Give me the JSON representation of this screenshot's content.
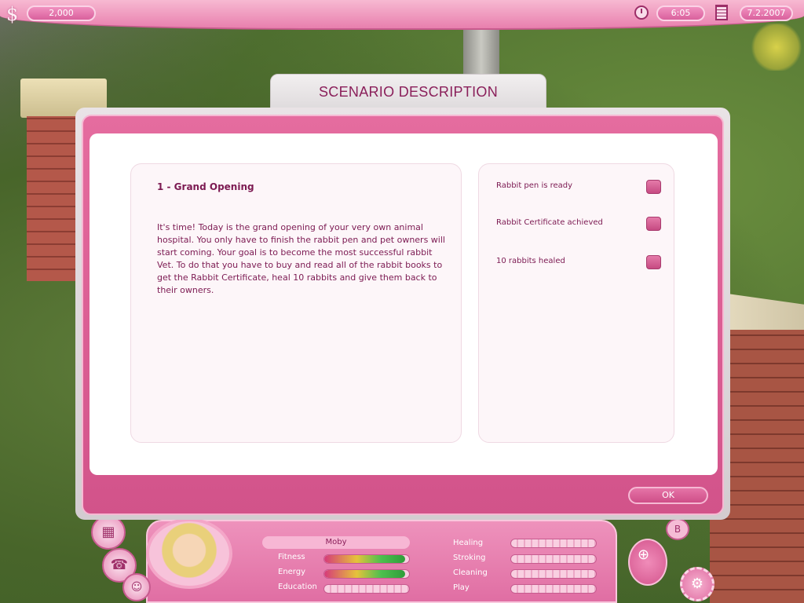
{
  "topbar": {
    "currency_symbol": "$",
    "money": "2,000",
    "time": "6:05",
    "date": "7.2.2007"
  },
  "dialog": {
    "title": "SCENARIO DESCRIPTION",
    "scenario_title": "1 - Grand Opening",
    "scenario_text": "It's time! Today is the grand opening of your very own animal hospital. You only have to finish the rabbit pen and pet owners will start coming. Your goal is to become the most successful rabbit Vet. To do that you have to buy and read all of the rabbit books to get the Rabbit Certificate, heal 10 rabbits and give them back to their owners.",
    "goals": [
      {
        "label": "Rabbit pen is ready"
      },
      {
        "label": "Rabbit Certificate achieved"
      },
      {
        "label": "10 rabbits healed"
      }
    ],
    "ok_label": "OK"
  },
  "hud": {
    "character_name": "Moby",
    "stats": [
      {
        "label": "Fitness",
        "value": 0.95
      },
      {
        "label": "Energy",
        "value": 0.95
      },
      {
        "label": "Education",
        "value": 0.0
      }
    ],
    "skills": [
      {
        "label": "Healing"
      },
      {
        "label": "Stroking"
      },
      {
        "label": "Cleaning"
      },
      {
        "label": "Play"
      }
    ]
  },
  "icons": {
    "money": "dollar-icon",
    "clock": "clock-icon",
    "calendar": "calculator-icon",
    "crib": "crib-icon",
    "phone": "phone-icon",
    "character": "character-icon",
    "nav": "navigation-wheel-icon",
    "settings": "gear-icon"
  },
  "colors": {
    "accent_pink": "#e56c9f",
    "title_text": "#8a1f5a",
    "body_text": "#7c1a52"
  }
}
